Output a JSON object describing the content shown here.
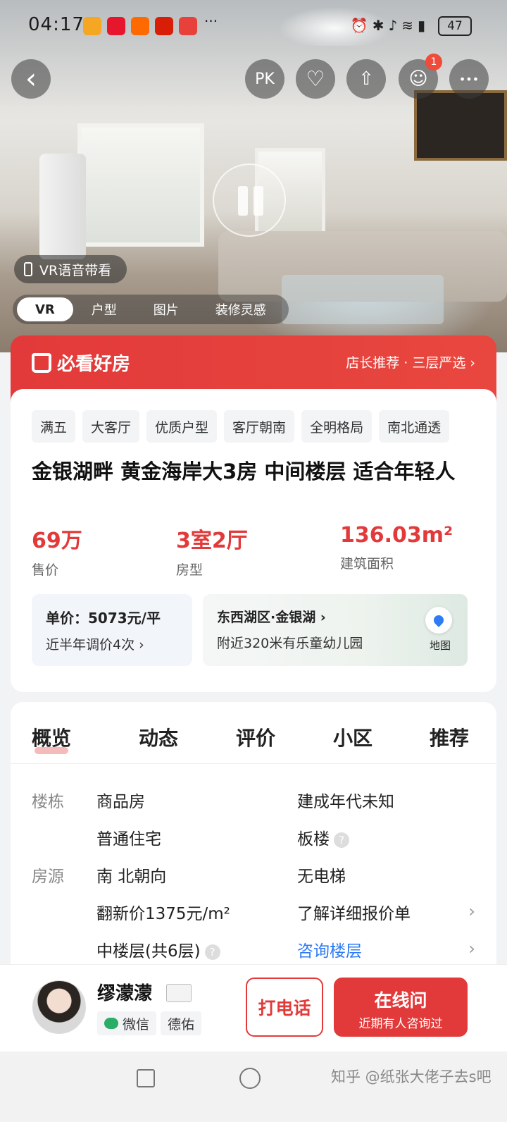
{
  "status_bar": {
    "time": "04:17",
    "battery": "47",
    "dots": "···"
  },
  "top_buttons": {
    "back": "‹",
    "pk": "PK",
    "favorite": "♡",
    "share": "⇧",
    "message": "☺",
    "message_badge": "1",
    "more": "•••"
  },
  "hero": {
    "vr_voice_label": "VR语音带看",
    "tabs": [
      "VR",
      "户型",
      "图片",
      "装修灵感"
    ]
  },
  "banner": {
    "logo_text": "必看好房",
    "right_text": "店长推荐 · 三层严选 ›"
  },
  "listing": {
    "tags": [
      "满五",
      "大客厅",
      "优质户型",
      "客厅朝南",
      "全明格局",
      "南北通透"
    ],
    "title": "金银湖畔 黄金海岸大3房 中间楼层 适合年轻人",
    "stats": [
      {
        "value": "69万",
        "label": "售价"
      },
      {
        "value": "3室2厅",
        "label": "房型"
      },
      {
        "value": "136.03m²",
        "label": "建筑面积"
      }
    ],
    "unit_price": "单价：5073元/平",
    "price_adjust": "近半年调价4次 ›",
    "location": "东西湖区·金银湖 ›",
    "nearby": "附近320米有乐童幼儿园",
    "map_label": "地图"
  },
  "overview": {
    "tabs": [
      "概览",
      "动态",
      "评价",
      "小区",
      "推荐"
    ],
    "building_label": "楼栋",
    "source_label": "房源",
    "type": "商品房",
    "year": "建成年代未知",
    "usage": "普通住宅",
    "structure": "板楼",
    "orientation": "南 北朝向",
    "elevator": "无电梯",
    "renovation_price": "翻新价1375元/m²",
    "price_detail": "了解详细报价单",
    "floor": "中楼层(共6层)",
    "ask_floor": "咨询楼层",
    "chevron": "›",
    "help": "?"
  },
  "agent": {
    "name": "缪濛濛",
    "wechat": "微信",
    "company": "德佑",
    "call": "打电话",
    "ask_title": "在线问",
    "ask_sub": "近期有人咨询过"
  },
  "navbar": {
    "watermark": "知乎 @纸张大佬子去s吧"
  },
  "colors": {
    "brand_red": "#e23a3a",
    "link_blue": "#2f7bf5"
  }
}
